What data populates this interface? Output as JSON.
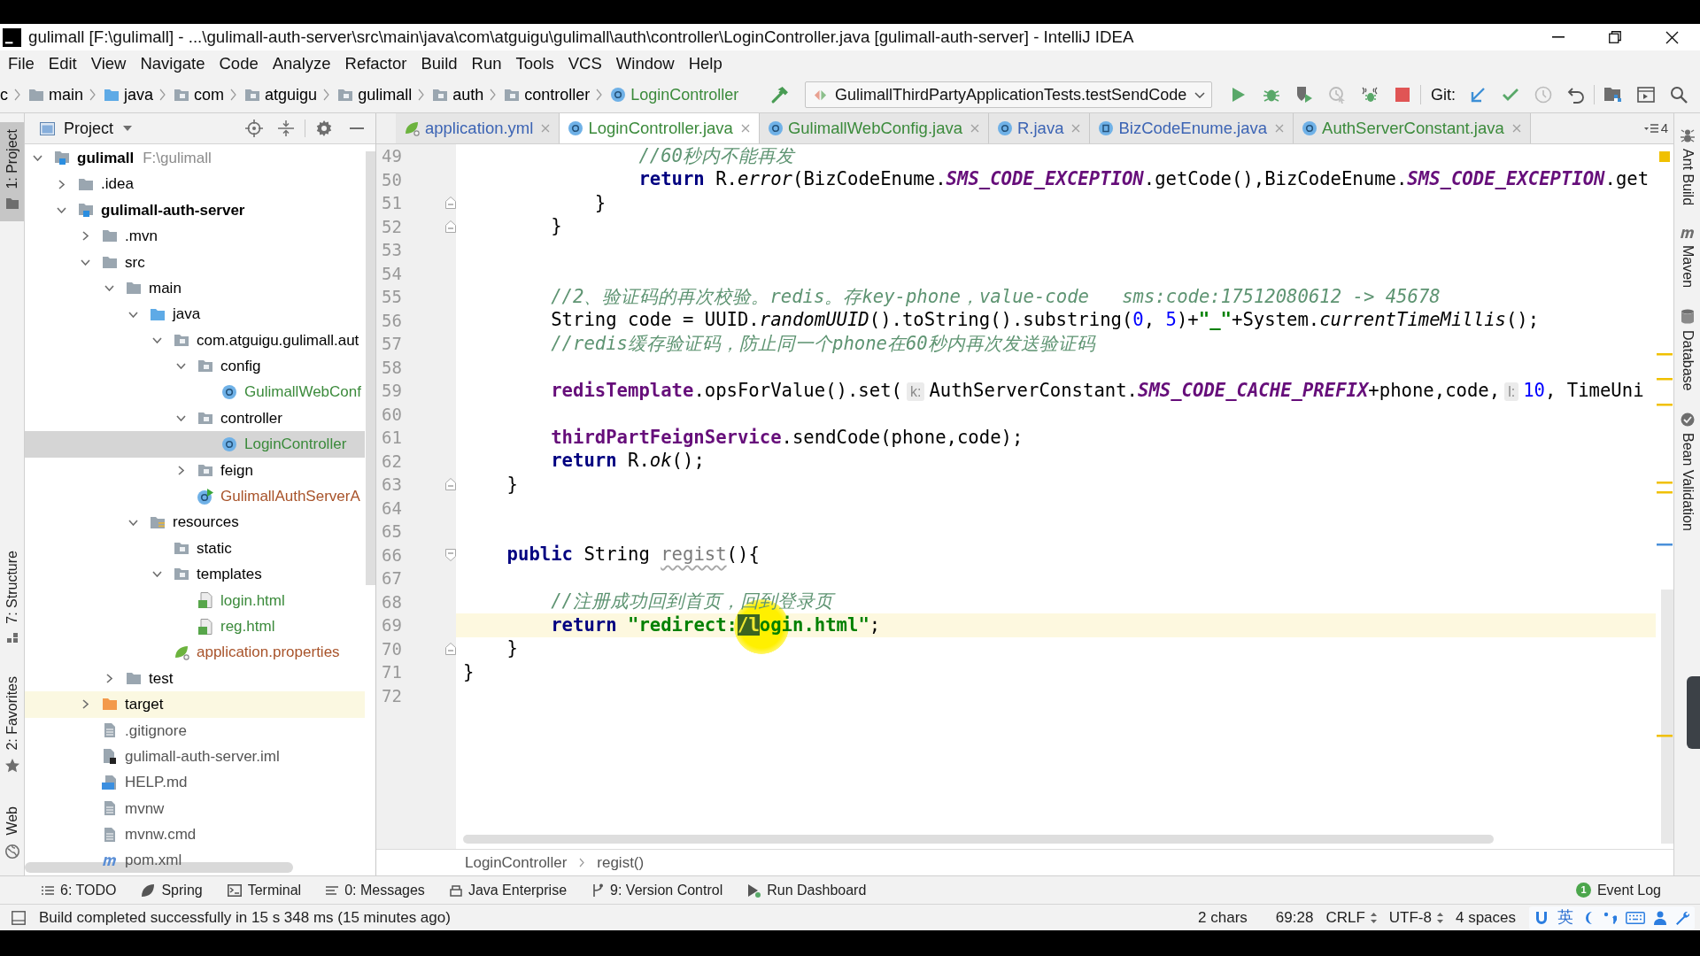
{
  "window": {
    "title": "gulimall [F:\\gulimall] - ...\\gulimall-auth-server\\src\\main\\java\\com\\atguigu\\gulimall\\auth\\controller\\LoginController.java [gulimall-auth-server] - IntelliJ IDEA"
  },
  "menu": [
    "File",
    "Edit",
    "View",
    "Navigate",
    "Code",
    "Analyze",
    "Refactor",
    "Build",
    "Run",
    "Tools",
    "VCS",
    "Window",
    "Help"
  ],
  "navigation_bar": {
    "items": [
      {
        "label": "c",
        "kind": "cut",
        "color": "#000000"
      },
      {
        "label": "main",
        "kind": "folder",
        "color": "#000000"
      },
      {
        "label": "java",
        "kind": "source-folder",
        "color": "#000000"
      },
      {
        "label": "com",
        "kind": "package",
        "color": "#000000"
      },
      {
        "label": "atguigu",
        "kind": "package",
        "color": "#000000"
      },
      {
        "label": "gulimall",
        "kind": "package",
        "color": "#000000"
      },
      {
        "label": "auth",
        "kind": "package",
        "color": "#000000"
      },
      {
        "label": "controller",
        "kind": "package",
        "color": "#000000"
      },
      {
        "label": "LoginController",
        "kind": "class",
        "color": "#3b8a3b"
      }
    ]
  },
  "toolbar": {
    "run_configuration": "GulimallThirdPartyApplicationTests.testSendCode",
    "vcs_label": "Git:"
  },
  "project_panel": {
    "title": "Project",
    "tree": [
      {
        "label": "gulimall",
        "hint": "F:\\gulimall",
        "kind": "module",
        "color": "#000000",
        "expanded": true,
        "selected": false,
        "highlighted": false,
        "children": [
          {
            "label": ".idea",
            "kind": "folder",
            "color": "#000000",
            "expanded": false,
            "selected": false,
            "highlighted": false
          },
          {
            "label": "gulimall-auth-server",
            "kind": "module",
            "color": "#000000",
            "expanded": true,
            "selected": false,
            "highlighted": false,
            "children": [
              {
                "label": ".mvn",
                "kind": "folder",
                "color": "#000000",
                "expanded": false,
                "selected": false,
                "highlighted": false
              },
              {
                "label": "src",
                "kind": "folder",
                "color": "#000000",
                "expanded": true,
                "selected": false,
                "highlighted": false,
                "children": [
                  {
                    "label": "main",
                    "kind": "folder",
                    "color": "#000000",
                    "expanded": true,
                    "selected": false,
                    "highlighted": false,
                    "children": [
                      {
                        "label": "java",
                        "kind": "source-folder",
                        "color": "#000000",
                        "expanded": true,
                        "selected": false,
                        "highlighted": false,
                        "children": [
                          {
                            "label": "com.atguigu.gulimall.aut",
                            "kind": "package",
                            "color": "#000000",
                            "expanded": true,
                            "selected": false,
                            "highlighted": false,
                            "children": [
                              {
                                "label": "config",
                                "kind": "package",
                                "color": "#000000",
                                "expanded": true,
                                "selected": false,
                                "highlighted": false,
                                "children": [
                                  {
                                    "label": "GulimallWebConf",
                                    "kind": "class",
                                    "color": "#3b8a3b",
                                    "selected": false,
                                    "highlighted": false
                                  }
                                ]
                              },
                              {
                                "label": "controller",
                                "kind": "package",
                                "color": "#000000",
                                "expanded": true,
                                "selected": false,
                                "highlighted": false,
                                "children": [
                                  {
                                    "label": "LoginController",
                                    "kind": "class",
                                    "color": "#3b8a3b",
                                    "selected": true,
                                    "highlighted": false
                                  }
                                ]
                              },
                              {
                                "label": "feign",
                                "kind": "package",
                                "color": "#000000",
                                "expanded": false,
                                "selected": false,
                                "highlighted": false
                              },
                              {
                                "label": "GulimallAuthServerA",
                                "kind": "spring-app",
                                "color": "#a8532a",
                                "selected": false,
                                "highlighted": false
                              }
                            ]
                          }
                        ]
                      },
                      {
                        "label": "resources",
                        "kind": "resources-folder",
                        "color": "#000000",
                        "expanded": true,
                        "selected": false,
                        "highlighted": false,
                        "children": [
                          {
                            "label": "static",
                            "kind": "package",
                            "color": "#000000",
                            "selected": false,
                            "highlighted": false
                          },
                          {
                            "label": "templates",
                            "kind": "package",
                            "color": "#000000",
                            "expanded": true,
                            "selected": false,
                            "highlighted": false,
                            "children": [
                              {
                                "label": "login.html",
                                "kind": "html",
                                "color": "#3b8a3b",
                                "selected": false,
                                "highlighted": false
                              },
                              {
                                "label": "reg.html",
                                "kind": "html",
                                "color": "#3b8a3b",
                                "selected": false,
                                "highlighted": false
                              }
                            ]
                          },
                          {
                            "label": "application.properties",
                            "kind": "properties",
                            "color": "#a8532a",
                            "selected": false,
                            "highlighted": false
                          }
                        ]
                      }
                    ]
                  },
                  {
                    "label": "test",
                    "kind": "folder",
                    "color": "#000000",
                    "expanded": false,
                    "selected": false,
                    "highlighted": false
                  }
                ]
              },
              {
                "label": "target",
                "kind": "excluded-folder",
                "color": "#000000",
                "expanded": false,
                "selected": false,
                "highlighted": true
              },
              {
                "label": ".gitignore",
                "kind": "text-file",
                "color": "#555555",
                "selected": false,
                "highlighted": false
              },
              {
                "label": "gulimall-auth-server.iml",
                "kind": "iml",
                "color": "#555555",
                "selected": false,
                "highlighted": false
              },
              {
                "label": "HELP.md",
                "kind": "markdown",
                "color": "#555555",
                "selected": false,
                "highlighted": false
              },
              {
                "label": "mvnw",
                "kind": "text-file",
                "color": "#555555",
                "selected": false,
                "highlighted": false
              },
              {
                "label": "mvnw.cmd",
                "kind": "text-file",
                "color": "#555555",
                "selected": false,
                "highlighted": false
              },
              {
                "label": "pom.xml",
                "kind": "maven",
                "color": "#555555",
                "selected": false,
                "highlighted": false
              }
            ]
          }
        ]
      }
    ]
  },
  "tabs": [
    {
      "label": "application.yml",
      "kind": "yaml",
      "color": "#3c64b4",
      "selected": false
    },
    {
      "label": "LoginController.java",
      "kind": "class",
      "color": "#3b8a3b",
      "selected": true
    },
    {
      "label": "GulimallWebConfig.java",
      "kind": "class",
      "color": "#3b8a3b",
      "selected": false
    },
    {
      "label": "R.java",
      "kind": "class",
      "color": "#3c64b4",
      "selected": false
    },
    {
      "label": "BizCodeEnume.java",
      "kind": "enum",
      "color": "#3c64b4",
      "selected": false
    },
    {
      "label": "AuthServerConstant.java",
      "kind": "class",
      "color": "#3b8a3b",
      "selected": false
    }
  ],
  "tab_overflow_count": "4",
  "editor": {
    "lines": [
      {
        "number": "49",
        "fold_start": false,
        "fold_end": false,
        "current": false,
        "tokens": [
          {
            "kind": "comment",
            "text": "                //60秒内不能再发"
          }
        ]
      },
      {
        "number": "50",
        "fold_start": false,
        "fold_end": false,
        "current": false,
        "tokens": [
          {
            "kind": "keyword",
            "text": "                return"
          },
          {
            "kind": "plain",
            "text": " R."
          },
          {
            "kind": "static-call",
            "text": "error"
          },
          {
            "kind": "plain",
            "text": "(BizCodeEnume."
          },
          {
            "kind": "constant",
            "text": "SMS_CODE_EXCEPTION"
          },
          {
            "kind": "plain",
            "text": ".getCode(),BizCodeEnume."
          },
          {
            "kind": "constant",
            "text": "SMS_CODE_EXCEPTION"
          },
          {
            "kind": "plain",
            "text": ".get"
          }
        ]
      },
      {
        "number": "51",
        "fold_start": false,
        "fold_end": true,
        "current": false,
        "tokens": [
          {
            "kind": "plain",
            "text": "            }"
          }
        ]
      },
      {
        "number": "52",
        "fold_start": false,
        "fold_end": true,
        "current": false,
        "tokens": [
          {
            "kind": "plain",
            "text": "        }"
          }
        ]
      },
      {
        "number": "53",
        "fold_start": false,
        "fold_end": false,
        "current": false
      },
      {
        "number": "54",
        "fold_start": false,
        "fold_end": false,
        "current": false
      },
      {
        "number": "55",
        "fold_start": false,
        "fold_end": false,
        "current": false,
        "tokens": [
          {
            "kind": "comment",
            "text": "        //2、验证码的再次校验。redis。存key-phone，value-code   sms:code:17512080612 -> 45678"
          }
        ]
      },
      {
        "number": "56",
        "fold_start": false,
        "fold_end": false,
        "current": false,
        "tokens": [
          {
            "kind": "plain",
            "text": "        String code = UUID."
          },
          {
            "kind": "static-call",
            "text": "randomUUID"
          },
          {
            "kind": "plain",
            "text": "().toString().substring("
          },
          {
            "kind": "number",
            "text": "0"
          },
          {
            "kind": "plain",
            "text": ", "
          },
          {
            "kind": "number",
            "text": "5"
          },
          {
            "kind": "plain",
            "text": ")+"
          },
          {
            "kind": "string",
            "text": "\"_\""
          },
          {
            "kind": "plain",
            "text": "+System."
          },
          {
            "kind": "static-call",
            "text": "currentTimeMillis"
          },
          {
            "kind": "plain",
            "text": "();"
          }
        ]
      },
      {
        "number": "57",
        "fold_start": false,
        "fold_end": false,
        "current": false,
        "tokens": [
          {
            "kind": "comment",
            "text": "        //redis缓存验证码，防止同一个phone在60秒内再次发送验证码"
          }
        ]
      },
      {
        "number": "58",
        "fold_start": false,
        "fold_end": false,
        "current": false
      },
      {
        "number": "59",
        "fold_start": false,
        "fold_end": false,
        "current": false,
        "tokens": [
          {
            "kind": "field",
            "text": "        redisTemplate"
          },
          {
            "kind": "plain",
            "text": ".opsForValue().set("
          },
          {
            "kind": "hint",
            "text": "k:"
          },
          {
            "kind": "plain",
            "text": "AuthServerConstant."
          },
          {
            "kind": "constant",
            "text": "SMS_CODE_CACHE_PREFIX"
          },
          {
            "kind": "plain",
            "text": "+phone,code,"
          },
          {
            "kind": "hint",
            "text": "l:"
          },
          {
            "kind": "number",
            "text": "10"
          },
          {
            "kind": "plain",
            "text": ", TimeUni"
          }
        ]
      },
      {
        "number": "60",
        "fold_start": false,
        "fold_end": false,
        "current": false
      },
      {
        "number": "61",
        "fold_start": false,
        "fold_end": false,
        "current": false,
        "tokens": [
          {
            "kind": "field",
            "text": "        thirdPartFeignService"
          },
          {
            "kind": "plain",
            "text": ".sendCode(phone,code);"
          }
        ]
      },
      {
        "number": "62",
        "fold_start": false,
        "fold_end": false,
        "current": false,
        "tokens": [
          {
            "kind": "keyword",
            "text": "        return"
          },
          {
            "kind": "plain",
            "text": " R."
          },
          {
            "kind": "static-call",
            "text": "ok"
          },
          {
            "kind": "plain",
            "text": "();"
          }
        ]
      },
      {
        "number": "63",
        "fold_start": false,
        "fold_end": true,
        "current": false,
        "tokens": [
          {
            "kind": "plain",
            "text": "    }"
          }
        ]
      },
      {
        "number": "64",
        "fold_start": false,
        "fold_end": false,
        "current": false
      },
      {
        "number": "65",
        "fold_start": false,
        "fold_end": false,
        "current": false
      },
      {
        "number": "66",
        "fold_start": true,
        "fold_end": false,
        "current": false,
        "tokens": [
          {
            "kind": "keyword",
            "text": "    public"
          },
          {
            "kind": "plain",
            "text": " String "
          },
          {
            "kind": "unused",
            "text": "regist"
          },
          {
            "kind": "plain",
            "text": "(){"
          }
        ]
      },
      {
        "number": "67",
        "fold_start": false,
        "fold_end": false,
        "current": false
      },
      {
        "number": "68",
        "fold_start": false,
        "fold_end": false,
        "current": false,
        "tokens": [
          {
            "kind": "comment",
            "text": "        //注册成功回到首页，回到登录页"
          }
        ]
      },
      {
        "number": "69",
        "fold_start": false,
        "fold_end": false,
        "current": true,
        "tokens": [
          {
            "kind": "keyword",
            "text": "        return "
          },
          {
            "kind": "string",
            "text": "\"redirect:"
          },
          {
            "kind": "selection",
            "text": "/l"
          },
          {
            "kind": "string",
            "text": "ogin.html\""
          },
          {
            "kind": "plain",
            "text": ";"
          }
        ]
      },
      {
        "number": "70",
        "fold_start": false,
        "fold_end": true,
        "current": false,
        "tokens": [
          {
            "kind": "plain",
            "text": "    }"
          }
        ]
      },
      {
        "number": "71",
        "fold_start": false,
        "fold_end": false,
        "current": false,
        "tokens": [
          {
            "kind": "plain",
            "text": "}"
          }
        ]
      },
      {
        "number": "72",
        "fold_start": false,
        "fold_end": false,
        "current": false
      }
    ],
    "breadcrumbs": [
      "LoginController",
      "regist()"
    ]
  },
  "left_tool_strip": {
    "top": [
      {
        "label": "1: Project",
        "kind": "project",
        "selected": true
      }
    ],
    "bottom": [
      {
        "label": "7: Structure",
        "kind": "structure",
        "selected": false
      },
      {
        "label": "2: Favorites",
        "kind": "favorites",
        "selected": false
      },
      {
        "label": "Web",
        "kind": "web",
        "selected": false
      }
    ]
  },
  "right_tool_strip": [
    {
      "label": "Ant Build",
      "kind": "ant",
      "selected": false
    },
    {
      "label": "Maven",
      "kind": "maven",
      "selected": false
    },
    {
      "label": "Database",
      "kind": "database",
      "selected": false
    },
    {
      "label": "Bean Validation",
      "kind": "bean-validation",
      "selected": false
    }
  ],
  "tool_window_bar": {
    "items": [
      {
        "label": "6: TODO",
        "kind": "todo",
        "selected": false
      },
      {
        "label": "Spring",
        "kind": "spring",
        "selected": false
      },
      {
        "label": "Terminal",
        "kind": "terminal",
        "selected": false
      },
      {
        "label": "0: Messages",
        "kind": "messages",
        "selected": false
      },
      {
        "label": "Java Enterprise",
        "kind": "java-enterprise",
        "selected": false
      },
      {
        "label": "9: Version Control",
        "kind": "version-control",
        "selected": false
      },
      {
        "label": "Run Dashboard",
        "kind": "run-dashboard",
        "selected": false
      }
    ],
    "event_log": {
      "label": "Event Log",
      "count": "1",
      "selected": false
    }
  },
  "status_bar": {
    "message": "Build completed successfully in 15 s 348 ms (15 minutes ago)",
    "items": [
      {
        "label": "2 chars",
        "kind": "text"
      },
      {
        "label": "69:28",
        "kind": "text"
      },
      {
        "label": "CRLF",
        "kind": "dropdown"
      },
      {
        "label": "UTF-8",
        "kind": "dropdown"
      },
      {
        "label": "4 spaces",
        "kind": "text"
      }
    ]
  },
  "ime_toolbar": {
    "mode": "英"
  }
}
